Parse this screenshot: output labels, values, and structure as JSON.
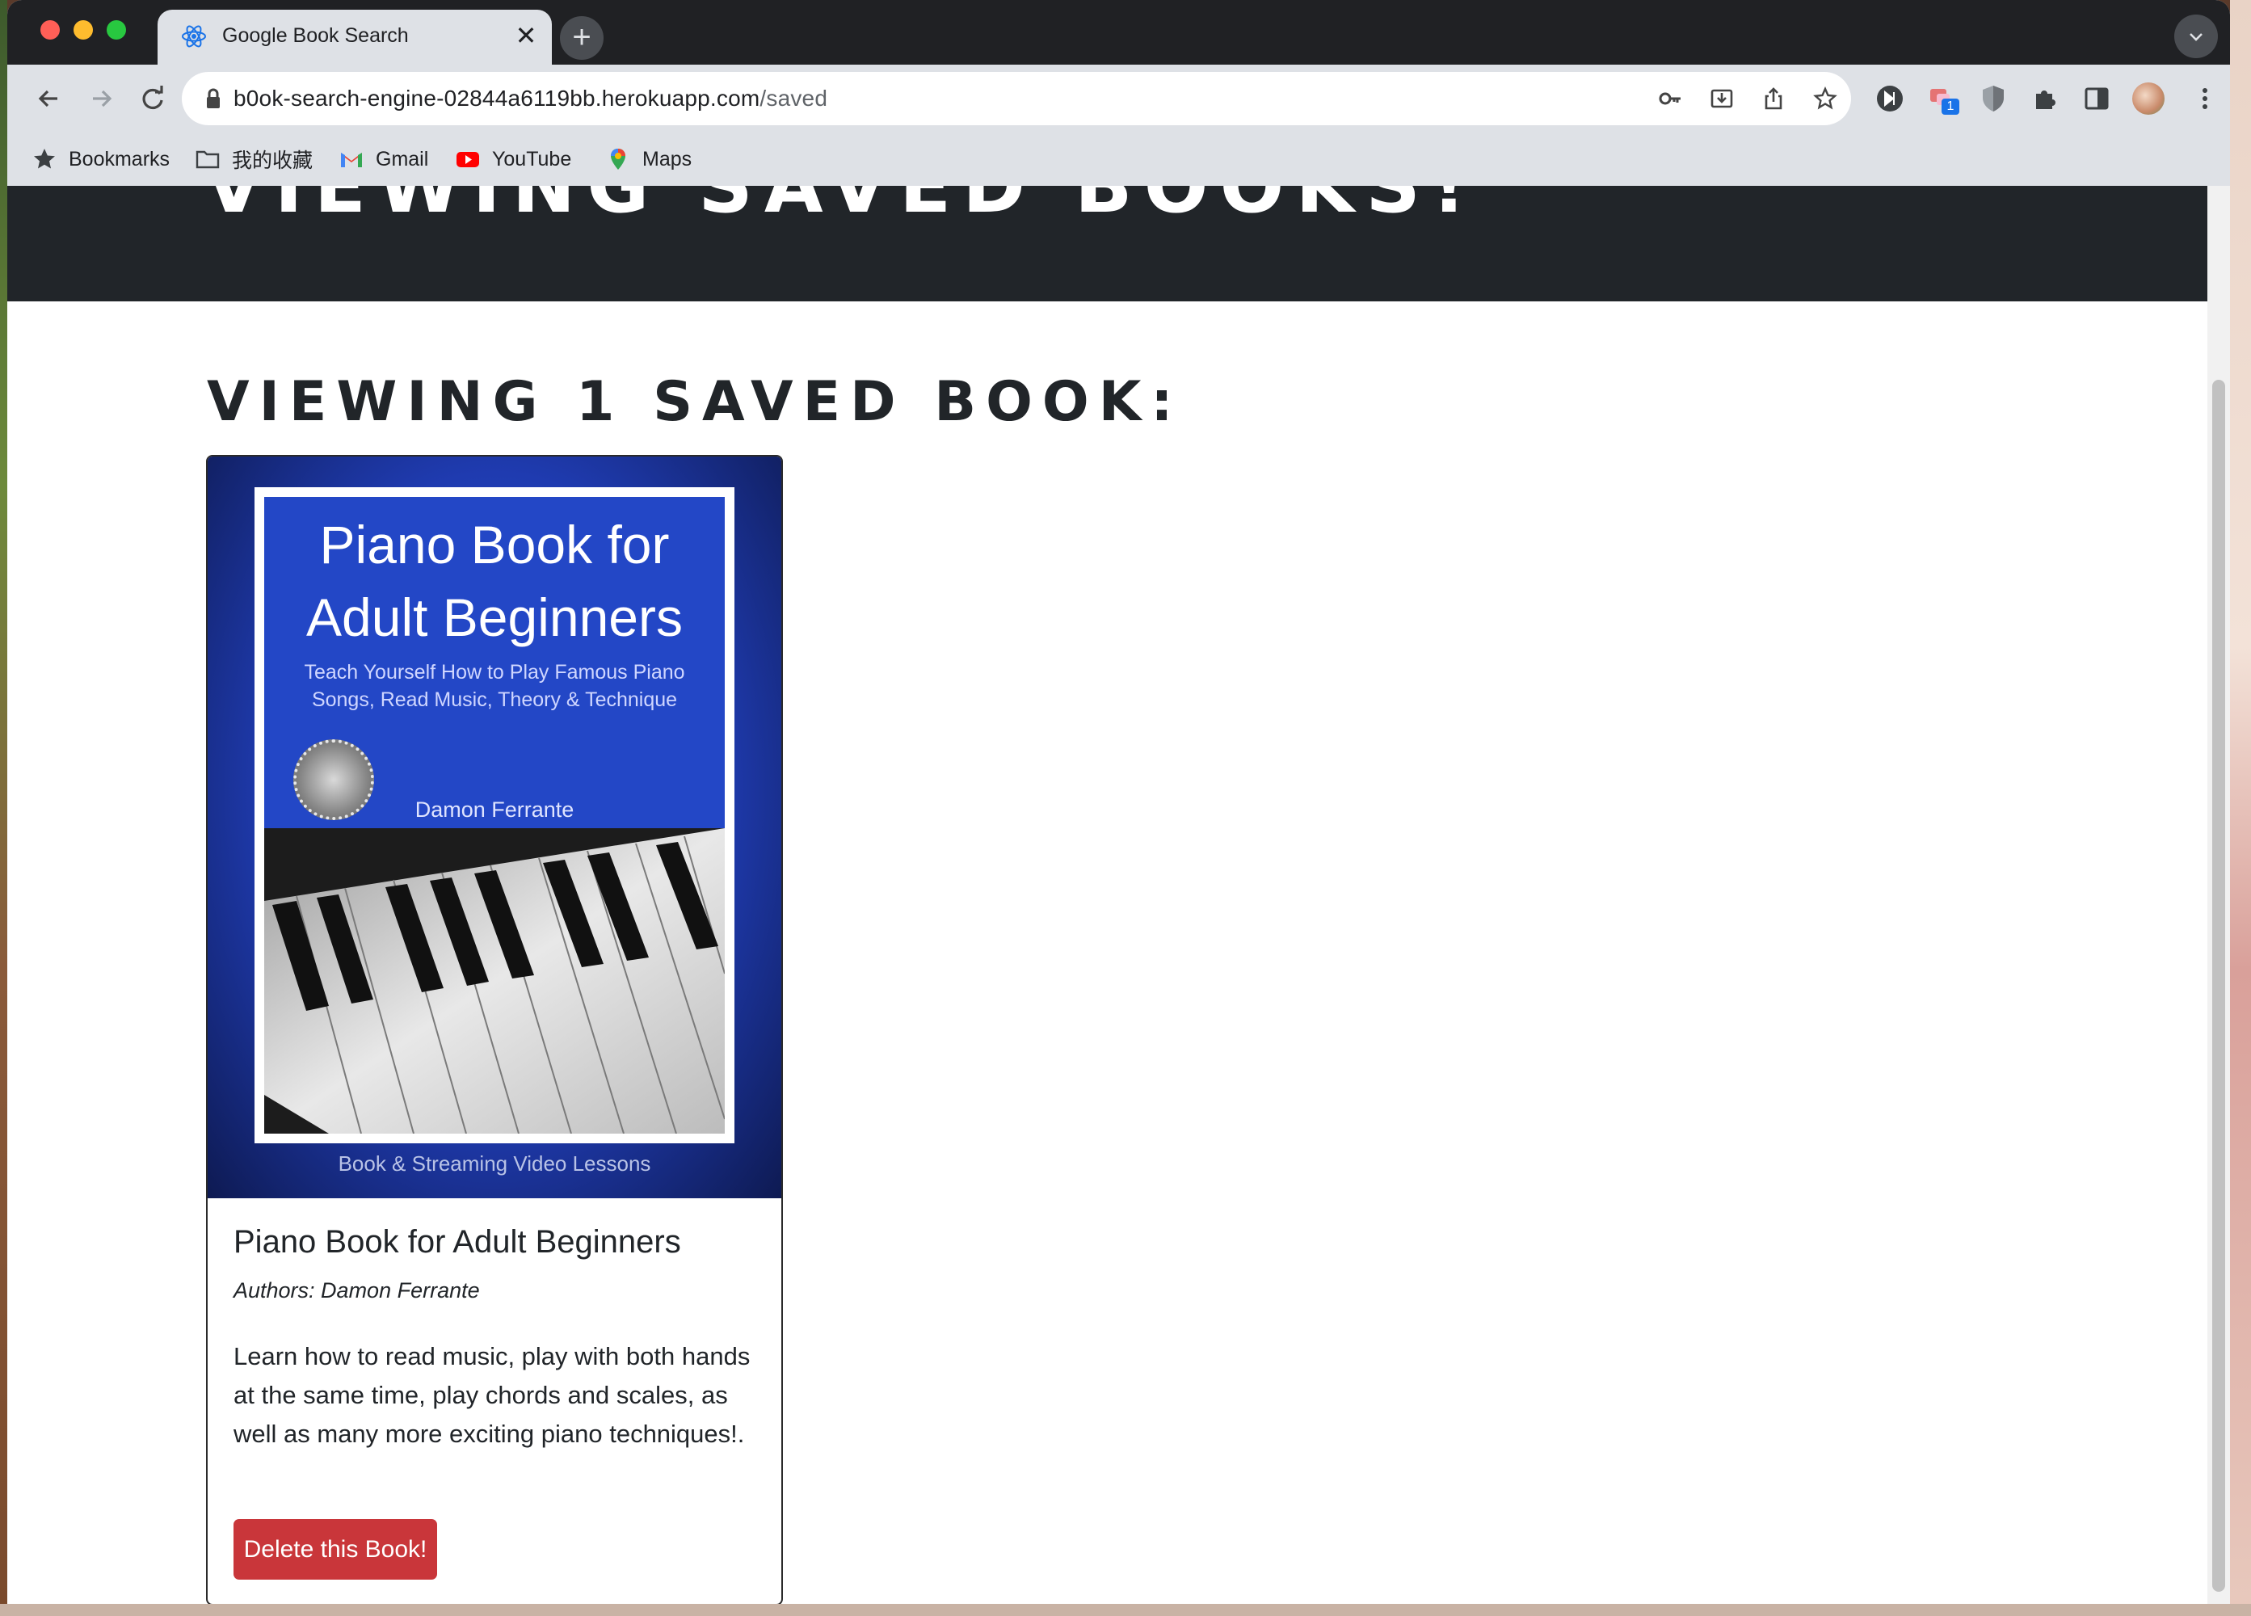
{
  "browser": {
    "tab_title": "Google Book Search",
    "url_host": "b0ok-search-engine-02844a6119bb.herokuapp.com",
    "url_path": "/saved",
    "extension_badge": "1"
  },
  "bookmarks": [
    {
      "label": "Bookmarks",
      "icon": "star-icon"
    },
    {
      "label": "我的收藏",
      "icon": "folder-icon"
    },
    {
      "label": "Gmail",
      "icon": "gmail-icon"
    },
    {
      "label": "YouTube",
      "icon": "youtube-icon"
    },
    {
      "label": "Maps",
      "icon": "maps-icon"
    }
  ],
  "page": {
    "hero_title": "Viewing saved books!",
    "heading": "Viewing 1 saved book:",
    "book": {
      "cover": {
        "title": "Piano Book for Adult Beginners",
        "subtitle": "Teach Yourself How to Play Famous Piano Songs, Read Music, Theory & Technique",
        "author": "Damon Ferrante",
        "caption": "Book & Streaming Video Lessons"
      },
      "title": "Piano Book for Adult Beginners",
      "authors": "Authors: Damon Ferrante",
      "description": "Learn how to read music, play with both hands at the same time, play chords and scales, as well as many more exciting piano techniques!.",
      "delete_label": "Delete this Book!"
    }
  },
  "colors": {
    "hero_bg": "#212529",
    "delete_button": "#c9363a",
    "chrome_bg": "#dee1e6"
  }
}
